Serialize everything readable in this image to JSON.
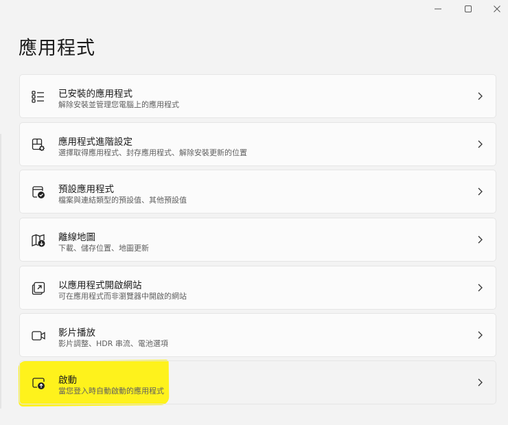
{
  "window": {
    "minimize_icon": "minimize-icon",
    "maximize_icon": "maximize-icon",
    "close_icon": "close-icon"
  },
  "page": {
    "title": "應用程式"
  },
  "items": [
    {
      "title": "已安裝的應用程式",
      "description": "解除安裝並管理您電腦上的應用程式",
      "icon": "installed-apps-list-icon"
    },
    {
      "title": "應用程式進階設定",
      "description": "選擇取得應用程式、封存應用程式、解除安裝更新的位置",
      "icon": "advanced-app-settings-icon"
    },
    {
      "title": "預設應用程式",
      "description": "檔案與連結類型的預設值、其他預設值",
      "icon": "default-apps-icon"
    },
    {
      "title": "離線地圖",
      "description": "下載、儲存位置、地圖更新",
      "icon": "offline-maps-icon"
    },
    {
      "title": "以應用程式開啟網站",
      "description": "可在應用程式而非瀏覽器中開啟的網站",
      "icon": "apps-for-websites-icon"
    },
    {
      "title": "影片播放",
      "description": "影片調整、HDR 串流、電池選項",
      "icon": "video-playback-icon"
    },
    {
      "title": "啟動",
      "description": "當您登入時自動啟動的應用程式",
      "icon": "startup-icon"
    }
  ],
  "colors": {
    "highlight": "#fff20a",
    "background": "#f3f3f3",
    "card": "#fbfbfb"
  }
}
